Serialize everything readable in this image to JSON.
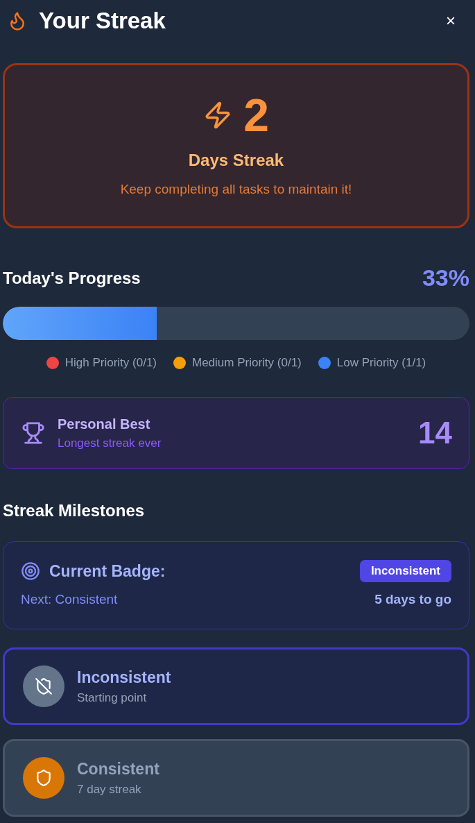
{
  "header": {
    "title": "Your Streak",
    "close": "×"
  },
  "streak": {
    "count": "2",
    "label": "Days Streak",
    "message": "Keep completing all tasks to maintain it!"
  },
  "progress": {
    "title": "Today's Progress",
    "percent": "33%",
    "level": 0.33,
    "legend": [
      {
        "label": "High Priority (0/1)",
        "color": "#ef4444"
      },
      {
        "label": "Medium Priority (0/1)",
        "color": "#f59e0b"
      },
      {
        "label": "Low Priority (1/1)",
        "color": "#3b82f6"
      }
    ]
  },
  "personal_best": {
    "title": "Personal Best",
    "subtitle": "Longest streak ever",
    "value": "14"
  },
  "milestones": {
    "title": "Streak Milestones",
    "current": {
      "label": "Current Badge:",
      "badge": "Inconsistent",
      "next": "Next: Consistent",
      "remaining": "5 days to go"
    },
    "items": [
      {
        "name": "Inconsistent",
        "description": "Starting point",
        "selected": true,
        "kind": "shield-off",
        "color": "#64748b"
      },
      {
        "name": "Consistent",
        "description": "7 day streak",
        "selected": false,
        "kind": "shield",
        "color": "#d97706"
      }
    ]
  }
}
